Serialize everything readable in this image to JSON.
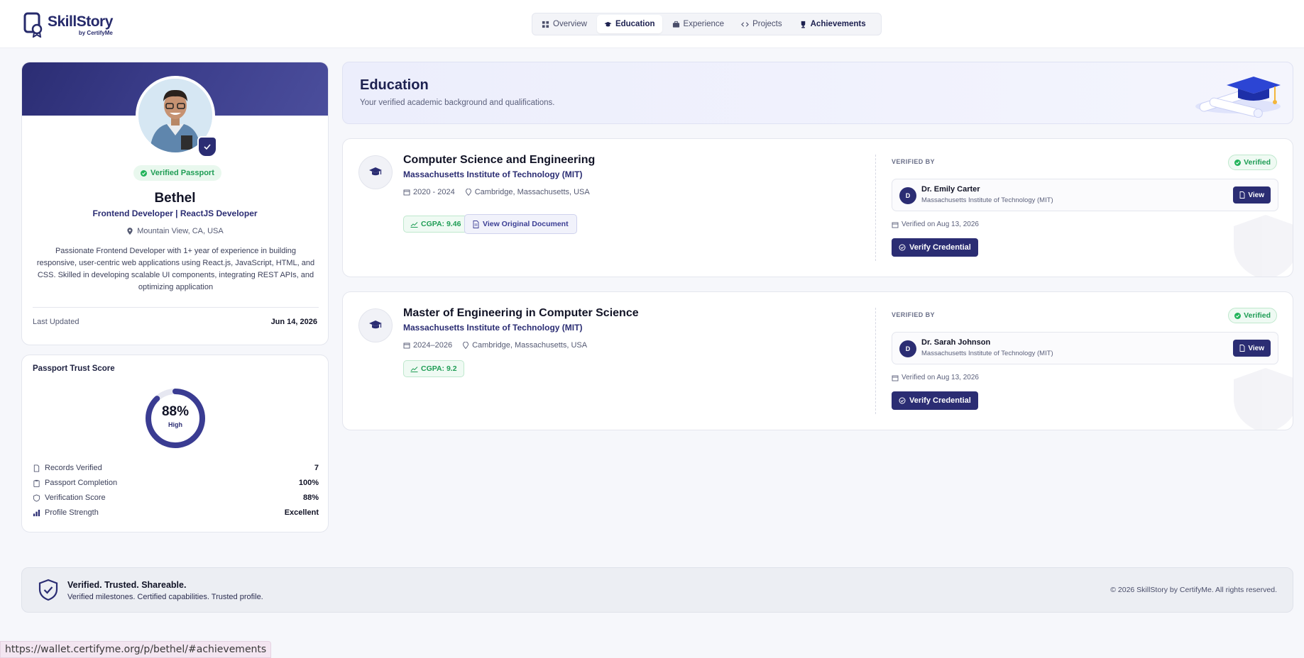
{
  "brand": {
    "name": "SkillStory",
    "sub": "by CertifyMe"
  },
  "nav": {
    "tabs": [
      {
        "label": "Overview",
        "icon": "grid-icon"
      },
      {
        "label": "Education",
        "icon": "graduation-cap-icon"
      },
      {
        "label": "Experience",
        "icon": "briefcase-icon"
      },
      {
        "label": "Projects",
        "icon": "code-icon"
      },
      {
        "label": "Achievements",
        "icon": "trophy-icon"
      }
    ],
    "active": "Education"
  },
  "profile": {
    "badge": "Verified Passport",
    "name": "Bethel",
    "role": "Frontend Developer | ReactJS Developer",
    "location": "Mountain View, CA, USA",
    "bio": "Passionate Frontend Developer with 1+ year of experience in building responsive, user-centric web applications using React.js, JavaScript, HTML, and CSS. Skilled in developing scalable UI components, integrating REST APIs, and optimizing application",
    "last_updated_label": "Last Updated",
    "last_updated_value": "Jun 14, 2026"
  },
  "trust": {
    "title": "Passport Trust Score",
    "score": "88%",
    "score_fraction": 0.88,
    "level": "High",
    "rows": [
      {
        "label": "Records Verified",
        "value": "7",
        "icon": "document-icon"
      },
      {
        "label": "Passport Completion",
        "value": "100%",
        "icon": "clipboard-icon"
      },
      {
        "label": "Verification Score",
        "value": "88%",
        "icon": "shield-icon"
      },
      {
        "label": "Profile Strength",
        "value": "Excellent",
        "icon": "bar-chart-icon"
      }
    ]
  },
  "education": {
    "title": "Education",
    "subtitle": "Your verified academic background and qualifications.",
    "records": [
      {
        "degree": "Computer Science and Engineering",
        "institution": "Massachusetts Institute of Technology (MIT)",
        "dates": "2020 - 2024",
        "location": "Cambridge, Massachusetts, USA",
        "cgpa": "CGPA: 9.46",
        "document_label": "View Original Document",
        "verified_by_label": "VERIFIED BY",
        "status": "Verified",
        "verifier_initial": "D",
        "verifier_name": "Dr. Emily Carter",
        "verifier_org": "Massachusetts Institute of Technology (MIT)",
        "view_label": "View",
        "verified_on": "Verified on Aug 13, 2026",
        "verify_label": "Verify Credential"
      },
      {
        "degree": "Master of Engineering in Computer Science",
        "institution": "Massachusetts Institute of Technology (MIT)",
        "dates": "2024–2026",
        "location": "Cambridge, Massachusetts, USA",
        "cgpa": "CGPA: 9.2",
        "verified_by_label": "VERIFIED BY",
        "status": "Verified",
        "verifier_initial": "D",
        "verifier_name": "Dr. Sarah Johnson",
        "verifier_org": "Massachusetts Institute of Technology (MIT)",
        "view_label": "View",
        "verified_on": "Verified on Aug 13, 2026",
        "verify_label": "Verify Credential"
      }
    ]
  },
  "footer": {
    "title": "Verified. Trusted. Shareable.",
    "subtitle": "Verified milestones. Certified capabilities. Trusted profile.",
    "copyright": "© 2026 SkillStory by CertifyMe. All rights reserved."
  },
  "status_bar": {
    "url": "https://wallet.certifyme.org/p/bethel/#achievements"
  },
  "colors": {
    "primary": "#2b2d73",
    "success": "#1f9d55",
    "background": "#f6f7fb"
  }
}
